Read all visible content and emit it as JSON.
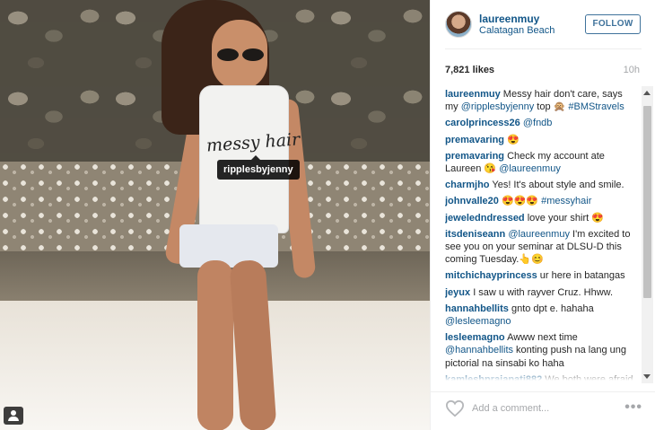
{
  "post": {
    "tag_label": "ripplesbyjenny",
    "shirt_print": "messy hair"
  },
  "header": {
    "username": "laureenmuy",
    "location": "Calatagan Beach",
    "follow_label": "FOLLOW"
  },
  "stats": {
    "likes": "7,821 likes",
    "time_ago": "10h"
  },
  "comments": [
    {
      "user": "laureenmuy",
      "parts": [
        {
          "t": " Messy hair don't care, says my "
        },
        {
          "m": "@ripplesbyjenny"
        },
        {
          "t": " top 🙊 "
        },
        {
          "m": "#BMStravels"
        }
      ]
    },
    {
      "user": "carolprincess26",
      "parts": [
        {
          "t": " "
        },
        {
          "m": "@fndb"
        }
      ]
    },
    {
      "user": "premavaring",
      "parts": [
        {
          "t": " 😍"
        }
      ]
    },
    {
      "user": "premavaring",
      "parts": [
        {
          "t": " Check my account ate Laureen 😘 "
        },
        {
          "m": "@laureenmuy"
        }
      ]
    },
    {
      "user": "charmjho",
      "parts": [
        {
          "t": " Yes! It's about style and smile."
        }
      ]
    },
    {
      "user": "johnvalle20",
      "parts": [
        {
          "t": " 😍😍😍 "
        },
        {
          "m": "#messyhair"
        }
      ]
    },
    {
      "user": "jeweledndressed",
      "parts": [
        {
          "t": " love your shirt 😍"
        }
      ]
    },
    {
      "user": "itsdeniseann",
      "parts": [
        {
          "t": " "
        },
        {
          "m": "@laureenmuy"
        },
        {
          "t": " I'm excited to see you on your seminar at DLSU-D this coming Tuesday.👆😊"
        }
      ]
    },
    {
      "user": "mitchichayprincess",
      "parts": [
        {
          "t": " ur here in batangas"
        }
      ]
    },
    {
      "user": "jeyux",
      "parts": [
        {
          "t": " I saw u with rayver Cruz. Hhww."
        }
      ]
    },
    {
      "user": "hannahbellits",
      "parts": [
        {
          "t": " gnto dpt e. hahaha "
        },
        {
          "m": "@lesleemagno"
        }
      ]
    },
    {
      "user": "lesleemagno",
      "parts": [
        {
          "t": " Awww next time "
        },
        {
          "m": "@hannahbellits"
        },
        {
          "t": " konting push na lang ung pictorial na sinsabi ko haha"
        }
      ]
    },
    {
      "user": "kamleshprajapati882",
      "parts": [
        {
          "t": " We both were afraid to talk to each other.... I love..."
        }
      ]
    }
  ],
  "footer": {
    "comment_placeholder": "Add a comment...",
    "more_label": "•••"
  },
  "colors": {
    "link_blue": "#125688",
    "follow_blue": "#3f729b",
    "muted_gray": "#a5a7aa"
  },
  "icons": {
    "heart": "heart-outline-icon",
    "user_tag": "person-tag-icon",
    "more": "more-horizontal-icon"
  }
}
